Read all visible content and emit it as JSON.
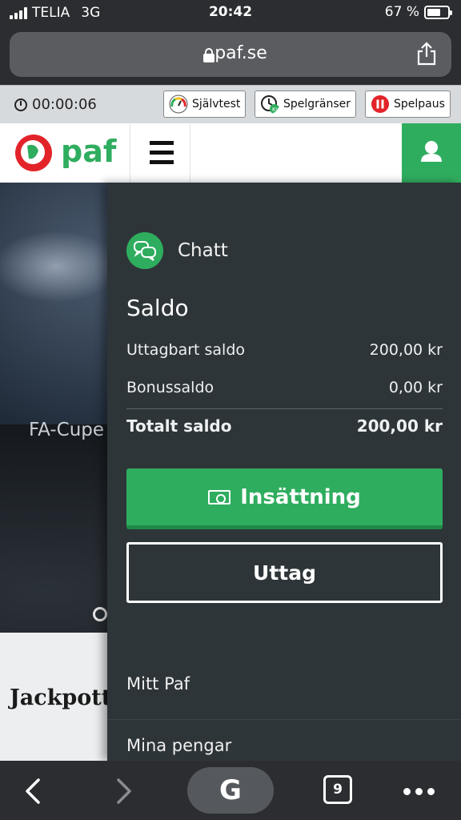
{
  "status_bar": {
    "carrier": "TELIA",
    "network": "3G",
    "time": "20:42",
    "battery_text": "67 %",
    "battery_level": 0.67
  },
  "browser": {
    "url": "paf.se",
    "tab_count": "9",
    "search_button": "G",
    "icons": [
      "lock-icon",
      "share-icon",
      "back-arrow-icon",
      "forward-arrow-icon",
      "more-icon"
    ]
  },
  "responsible_gaming": {
    "session_timer": "00:00:06",
    "buttons": [
      {
        "label": "Självtest",
        "icon": "gauge-icon"
      },
      {
        "label": "Spelgränser",
        "icon": "limit-clock-icon"
      },
      {
        "label": "Spelpaus",
        "icon": "pause-icon"
      }
    ]
  },
  "header": {
    "logo_text": "paf",
    "brand_green": "#2fad5f",
    "brand_red": "#e2242a"
  },
  "hero": {
    "title": "FA-Cupe",
    "section_heading": "Jackpott"
  },
  "drawer": {
    "chat_label": "Chatt",
    "balance_title": "Saldo",
    "rows": [
      {
        "label": "Uttagbart saldo",
        "value": "200,00 kr"
      },
      {
        "label": "Bonussaldo",
        "value": "0,00 kr"
      }
    ],
    "total": {
      "label": "Totalt saldo",
      "value": "200,00 kr"
    },
    "deposit_label": "Insättning",
    "withdraw_label": "Uttag",
    "menu": [
      {
        "label": "Mitt Paf"
      },
      {
        "label": "Mina pengar"
      }
    ]
  }
}
